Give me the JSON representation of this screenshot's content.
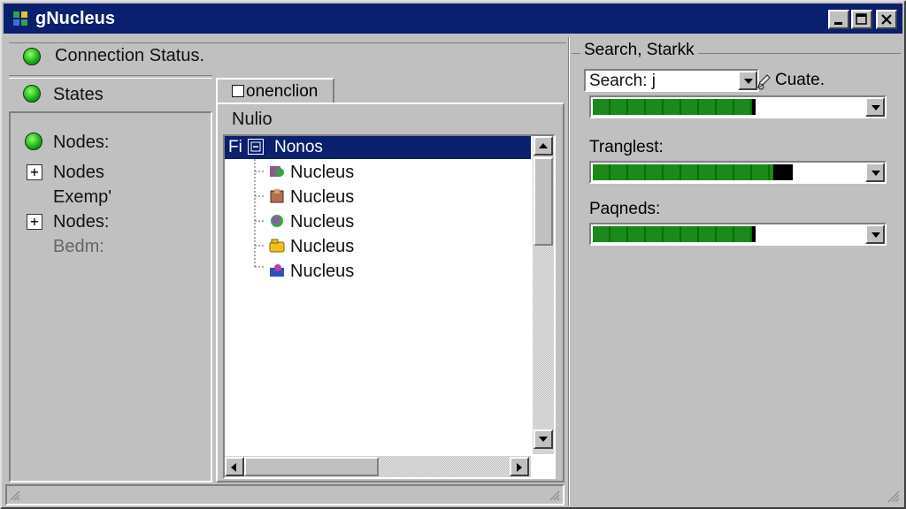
{
  "window": {
    "title": "gNucleus"
  },
  "left_panel": {
    "connection_status": "Connection Status.",
    "states": "States",
    "nodes_items": [
      {
        "label": "Nodes:",
        "kind": "led"
      },
      {
        "label": "Nodes",
        "kind": "plus"
      },
      {
        "label": "Exemp'",
        "kind": "text"
      },
      {
        "label": "Nodes:",
        "kind": "plus"
      },
      {
        "label": "Bedm:",
        "kind": "text-gray"
      }
    ]
  },
  "middle_panel": {
    "tab_label": "onenclion",
    "header": "Nulio",
    "tree_root_prefix": "Fi",
    "tree_root_label": "Nonos",
    "tree_children": [
      "Nucleus",
      "Nucleus",
      "Nucleus",
      "Nucleus",
      "Nucleus"
    ]
  },
  "right_panel": {
    "group_title": "Search, Starkk",
    "search_value": "Search: j",
    "create_label": "Cuate.",
    "progress1_value": 0.6,
    "label2": "Tranglest:",
    "progress2_value": 0.68,
    "label3": "Paqneds:",
    "progress3_value": 0.6
  },
  "colors": {
    "titlebar": "#0a1f6e",
    "progress": "#1a8a1a",
    "led": "#1fb11a",
    "selection": "#0a1f6e"
  }
}
